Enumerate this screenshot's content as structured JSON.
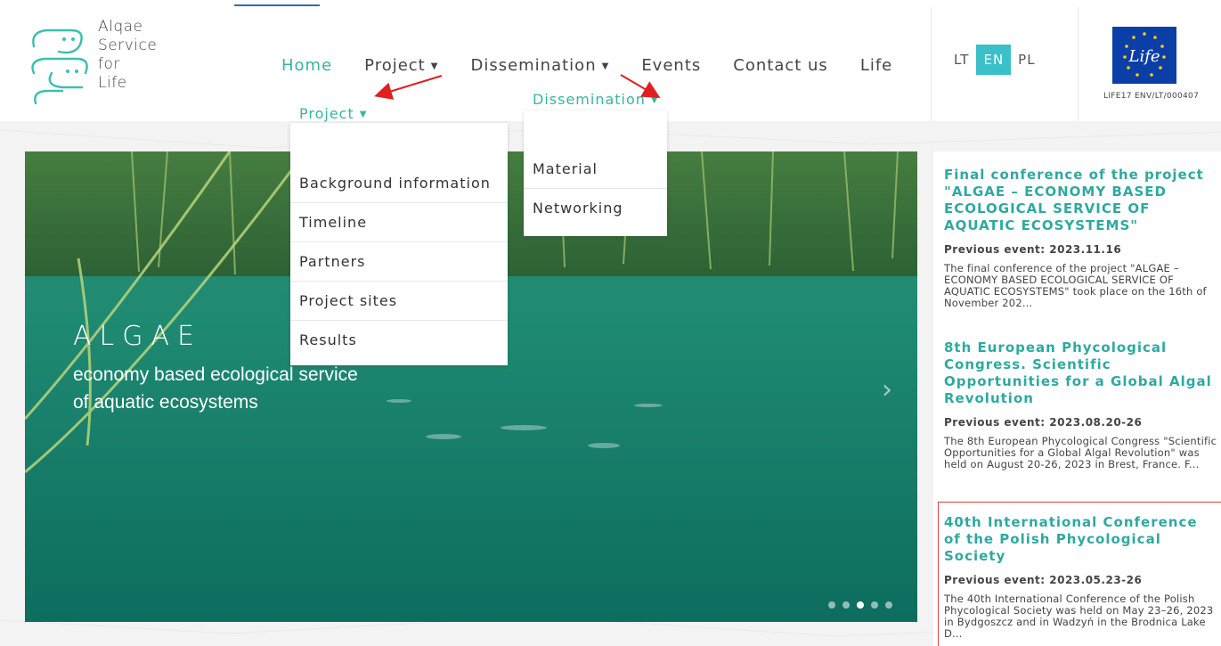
{
  "logo": {
    "lines": [
      "Alqae",
      "Service",
      "for",
      "Life"
    ]
  },
  "nav": {
    "items": [
      {
        "label": "Home",
        "active": true,
        "caret": false
      },
      {
        "label": "Project",
        "active": false,
        "caret": true
      },
      {
        "label": "Dissemination",
        "active": false,
        "caret": true
      },
      {
        "label": "Events",
        "active": false,
        "caret": false
      },
      {
        "label": "Contact us",
        "active": false,
        "caret": false
      },
      {
        "label": "Life",
        "active": false,
        "caret": false
      }
    ],
    "caret_glyph": "▼"
  },
  "lang": {
    "items": [
      "LT",
      "EN",
      "PL"
    ],
    "selected": "EN"
  },
  "eu": {
    "code": "LIFE17 ENV/LT/000407"
  },
  "hero": {
    "title": "ALGAE",
    "subtitle_line1": "economy based ecological service",
    "subtitle_line2": "of aquatic ecosystems",
    "slides": 5,
    "active_slide": 3
  },
  "project_menu": {
    "header": "Project",
    "items": [
      "Background information",
      "Timeline",
      "Partners",
      "Project sites",
      "Results"
    ]
  },
  "dissemination_menu": {
    "header": "Dissemination",
    "items": [
      "Material",
      "Networking"
    ]
  },
  "events": [
    {
      "title": "Final conference of the project \"ALGAE – ECONOMY BASED ECOLOGICAL SERVICE OF AQUATIC ECOSYSTEMS\"",
      "date": "Previous event: 2023.11.16",
      "text": "The final conference of the project \"ALGAE – ECONOMY BASED ECOLOGICAL SERVICE OF AQUATIC ECOSYSTEMS\" took place on the 16th of November 202..."
    },
    {
      "title": "8th European Phycological Congress. Scientific Opportunities for a Global Algal Revolution",
      "date": "Previous event: 2023.08.20-26",
      "text": "The 8th European Phycological Congress \"Scientific Opportunities for a Global Algal Revolution\" was held on August 20-26, 2023 in Brest, France. F..."
    },
    {
      "title": "40th International Conference of the Polish Phycological Society",
      "date": "Previous event: 2023.05.23-26",
      "text": "The 40th International Conference of the Polish Phycological Society was held on May 23–26, 2023 in Bydgoszcz and in Wadzyń in the Brodnica Lake D..."
    }
  ],
  "colors": {
    "accent": "#36b5a0",
    "lang_selected": "#39c0c8",
    "annotation_arrow": "#e02020",
    "event_title": "#2fa9a0",
    "eu_blue": "#0c3ea8"
  }
}
